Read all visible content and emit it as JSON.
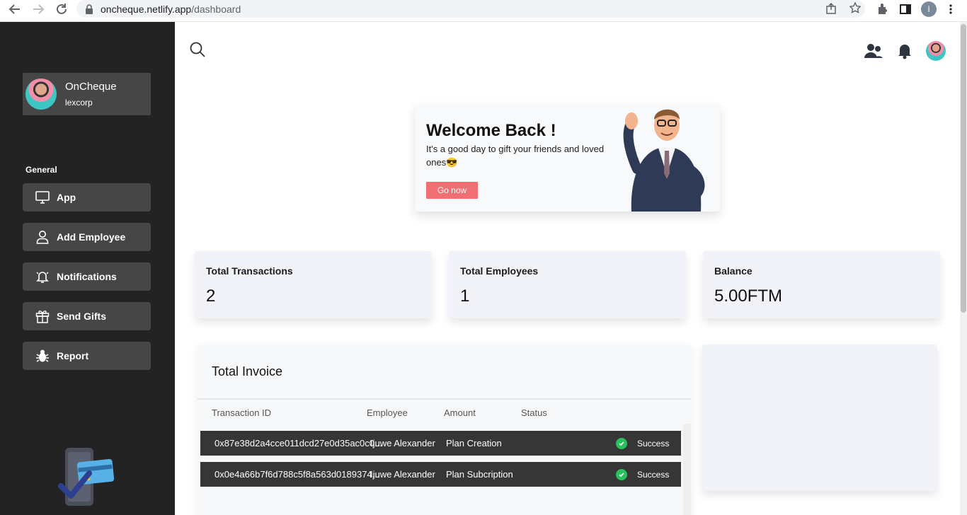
{
  "browser": {
    "url_domain": "oncheque.netlify.app",
    "url_path": "/dashboard",
    "profile_initial": "I"
  },
  "sidebar": {
    "profile": {
      "name": "OnCheque",
      "org": "lexcorp"
    },
    "section_label": "General",
    "items": [
      {
        "label": "App",
        "icon": "monitor-icon"
      },
      {
        "label": "Add Employee",
        "icon": "user-icon"
      },
      {
        "label": "Notifications",
        "icon": "bell-icon"
      },
      {
        "label": "Send Gifts",
        "icon": "gift-icon"
      },
      {
        "label": "Report",
        "icon": "bug-icon"
      }
    ]
  },
  "welcome": {
    "title": "Welcome Back !",
    "subtitle": "It's a good day to gift your friends and loved ones😎",
    "button": "Go now"
  },
  "stats": [
    {
      "label": "Total Transactions",
      "value": "2"
    },
    {
      "label": "Total Employees",
      "value": "1"
    },
    {
      "label": "Balance",
      "value": "5.00FTM"
    }
  ],
  "invoice": {
    "title": "Total Invoice",
    "columns": [
      "Transaction ID",
      "Employee",
      "Amount",
      "Status"
    ],
    "rows": [
      {
        "id": "0x87e38d2a4cce011dcd27e0d35ac0c0...",
        "employee": "Ijuwe Alexander",
        "amount": "Plan Creation",
        "status": "Success"
      },
      {
        "id": "0x0e4a66b7f6d788c5f8a563d0189374...",
        "employee": "Ijuwe Alexander",
        "amount": "Plan Subcription",
        "status": "Success"
      }
    ]
  },
  "colors": {
    "sidebar_bg": "#232323",
    "menu_item_bg": "#464646",
    "accent_button": "#ef6f73",
    "success": "#27c25d",
    "card_bg": "#f1f3f8"
  }
}
